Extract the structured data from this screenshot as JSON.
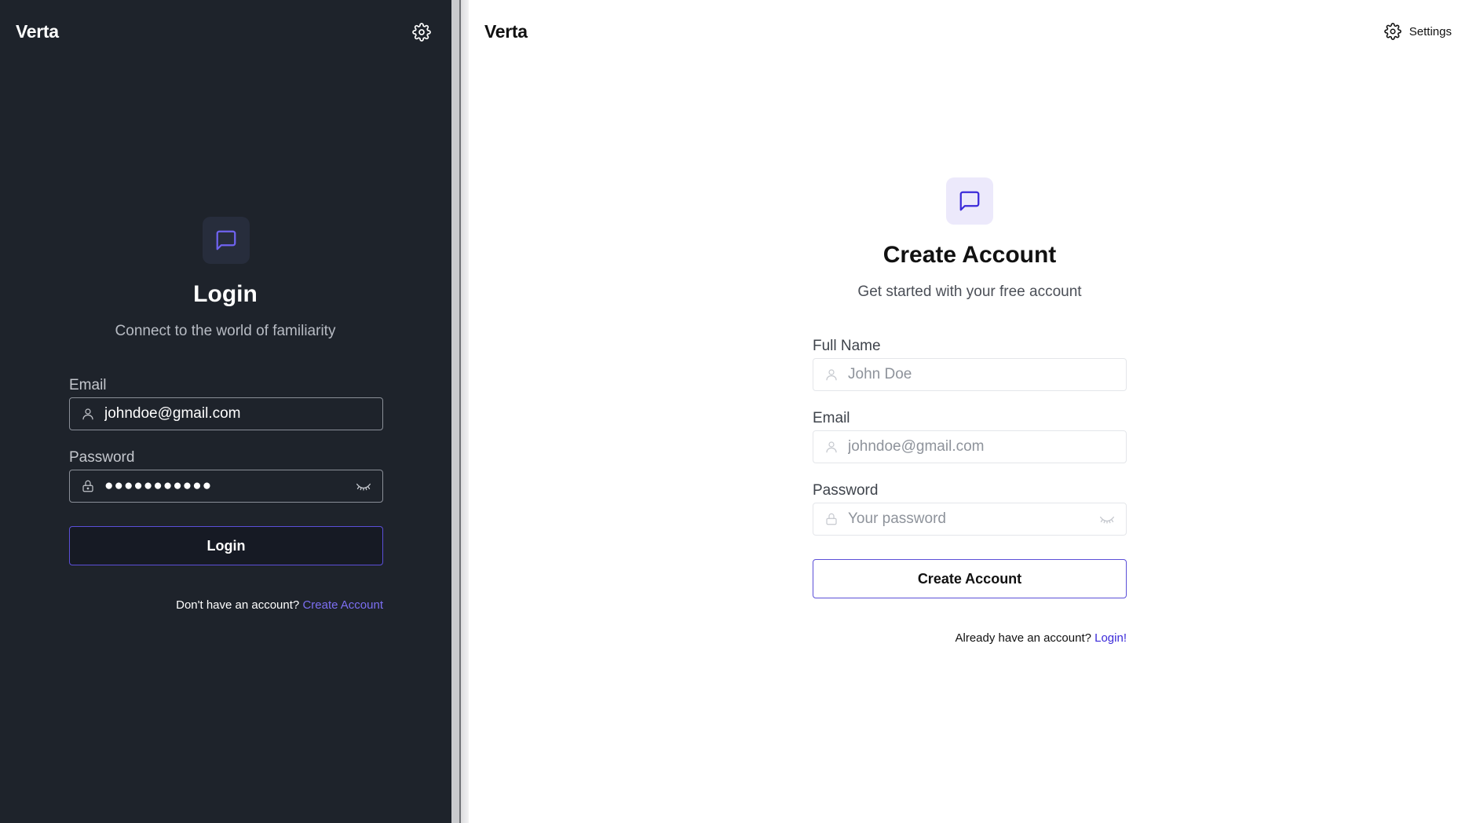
{
  "login_panel": {
    "brand": "Verta",
    "icon": "gear-icon",
    "title": "Login",
    "subtitle": "Connect to the world of familiarity",
    "email": {
      "label": "Email",
      "value": "johndoe@gmail.com"
    },
    "password": {
      "label": "Password",
      "value": "●●●●●●●●●●●"
    },
    "submit_label": "Login",
    "footer_text": "Don't have an account?",
    "footer_link": "Create Account",
    "colors": {
      "background": "#1e232b",
      "accent": "#7c6ff2",
      "button_border": "#5b4fd8"
    }
  },
  "signup_panel": {
    "brand": "Verta",
    "settings_label": "Settings",
    "title": "Create Account",
    "subtitle": "Get started with your free account",
    "full_name": {
      "label": "Full Name",
      "placeholder": "John Doe"
    },
    "email": {
      "label": "Email",
      "placeholder": "johndoe@gmail.com"
    },
    "password": {
      "label": "Password",
      "placeholder": "Your password"
    },
    "submit_label": "Create Account",
    "footer_text": "Already have an account?",
    "footer_link": "Login!",
    "colors": {
      "background": "#ffffff",
      "icon_tile": "#ece9fb",
      "link": "#3b2ad9",
      "button_border": "#5b4fd8"
    }
  }
}
